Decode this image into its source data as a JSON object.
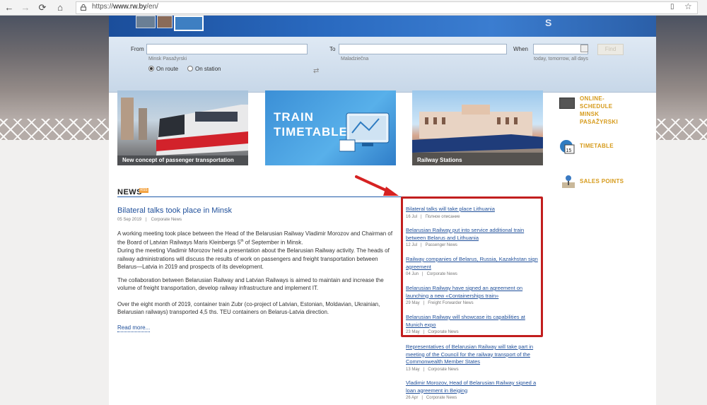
{
  "browser": {
    "url_prefix": "https://",
    "url_host": "www.rw.by",
    "url_path": "/en/"
  },
  "search": {
    "from_label": "From",
    "from_hint": "Minsk Pasažyrski",
    "to_label": "To",
    "to_hint": "Maladziečna",
    "when_label": "When",
    "when_hint": "today, tomorrow, all days",
    "find_label": "Find",
    "radio_on_route": "On route",
    "radio_on_station": "On station"
  },
  "promos": [
    {
      "caption": "New concept of passenger transportation"
    },
    {
      "caption": "TRAIN",
      "caption2": "TIMETABLE"
    },
    {
      "caption": "Railway Stations"
    }
  ],
  "side_links": [
    {
      "lines": [
        "ONLINE-",
        "SCHEDULE",
        "MINSK",
        "PASAŽYRSKI"
      ],
      "icon": "board-icon"
    },
    {
      "lines": [
        "TIMETABLE"
      ],
      "icon": "calendar-icon",
      "badge": "15"
    },
    {
      "lines": [
        "SALES POINTS"
      ],
      "icon": "map-pin-icon"
    }
  ],
  "news": {
    "heading": "NEWS",
    "rss": "RSS",
    "main_article": {
      "title": "Bilateral talks took place in Minsk",
      "date": "05 Sep 2019",
      "category": "Corporate News",
      "para1_a": "A working meeting took place between the Head of the Belarusian Railway Vladimir Morozov and Chairman of the Board of Latvian Railways Maris Kleinbergs 5",
      "para1_sup": "th",
      "para1_b": " of September in Minsk.",
      "para2": "During the meeting Vladimir Morozov held a presentation about the Belarusian Railway activity. The heads of railway administrations will discuss the results of work on passengers and freight transportation between Belarus—Latvia in 2019 and prospects of its development.",
      "para3": "The collaboration between Belarusian Railway and Latvian Railways is aimed to maintain and increase the volume of freight transportation, develop railway infrastructure and implement IT.",
      "para4": "Over the eight month of 2019, container train Zubr (co-project of Latvian, Estonian, Moldavian, Ukrainian, Belarusian railways) transported 4,5 ths. TEU containers on Belarus-Latvia direction.",
      "read_more": "Read more..."
    },
    "list": [
      {
        "title": "Bilateral talks will take place Lithuania",
        "date": "16 Jul",
        "category": "Полное описание"
      },
      {
        "title": "Belarusian Railway put into service additional train between Belarus and Lithuania",
        "date": "12 Jul",
        "category": "Passenger News"
      },
      {
        "title": "Railway companies of Belarus, Russia, Kazakhstan sign agreement",
        "date": "04 Jun",
        "category": "Corporate News"
      },
      {
        "title": "Belarusian Railway have signed an agreement on launching a new «Containerships train»",
        "date": "29 May",
        "category": "Freight Forwarder News"
      },
      {
        "title": "Belarusian Railway will showcase its capabilities at Munich expo",
        "date": "23 May",
        "category": "Corporate News"
      },
      {
        "title": "Representatives of Belarusian Railway will take part in meeting of the Council for the railway transport of the Commonwealth Member States",
        "date": "13 May",
        "category": "Corporate News"
      },
      {
        "title": "Vladimir Morozov, Head of Belarusian Railway signed a loan agreement in Beiging",
        "date": "26 Apr",
        "category": "Corporate News"
      }
    ]
  },
  "colors": {
    "link": "#1f4f9a",
    "accent_orange": "#d69a1a",
    "highlight_red": "#c21e1e"
  }
}
